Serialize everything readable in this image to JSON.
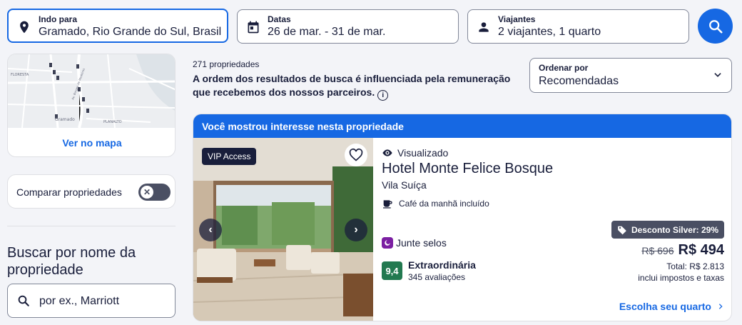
{
  "search": {
    "destination": {
      "label": "Indo para",
      "value": "Gramado, Rio Grande do Sul, Brasil"
    },
    "dates": {
      "label": "Datas",
      "value": "26 de mar. - 31 de mar."
    },
    "travelers": {
      "label": "Viajantes",
      "value": "2 viajantes, 1 quarto"
    }
  },
  "sidebar": {
    "map_link": "Ver no mapa",
    "map_labels": [
      "FLORESTA",
      "Gramado",
      "PLANALTO",
      "Av. Borges de Medeiros"
    ],
    "compare_label": "Comparar propriedades",
    "compare_enabled": false,
    "name_search_title": "Buscar por nome da propriedade",
    "name_search_placeholder": "por ex., Marriott"
  },
  "results": {
    "count": "271 propriedades",
    "disclaimer": "A ordem dos resultados de busca é influenciada pela remuneração que recebemos dos nossos parceiros.",
    "sort": {
      "label": "Ordenar por",
      "value": "Recomendadas"
    }
  },
  "listing": {
    "banner": "Você mostrou interesse nesta propriedade",
    "badge": "VIP Access",
    "viewed": "Visualizado",
    "name": "Hotel Monte Felice Bosque",
    "neighborhood": "Vila Suíça",
    "amenity": "Café da manhã incluído",
    "stamps": "Junte selos",
    "score": "9,4",
    "rating_word": "Extraordinária",
    "reviews": "345 avaliações",
    "discount": "Desconto Silver: 29%",
    "old_price": "R$ 696",
    "price": "R$ 494",
    "total": "Total: R$ 2.813",
    "taxes": "inclui impostos e taxas",
    "choose": "Escolha seu quarto"
  },
  "colors": {
    "accent": "#1668e3",
    "text": "#191e3b",
    "rating_green": "#227950",
    "stamp_purple": "#7b1fa2"
  }
}
